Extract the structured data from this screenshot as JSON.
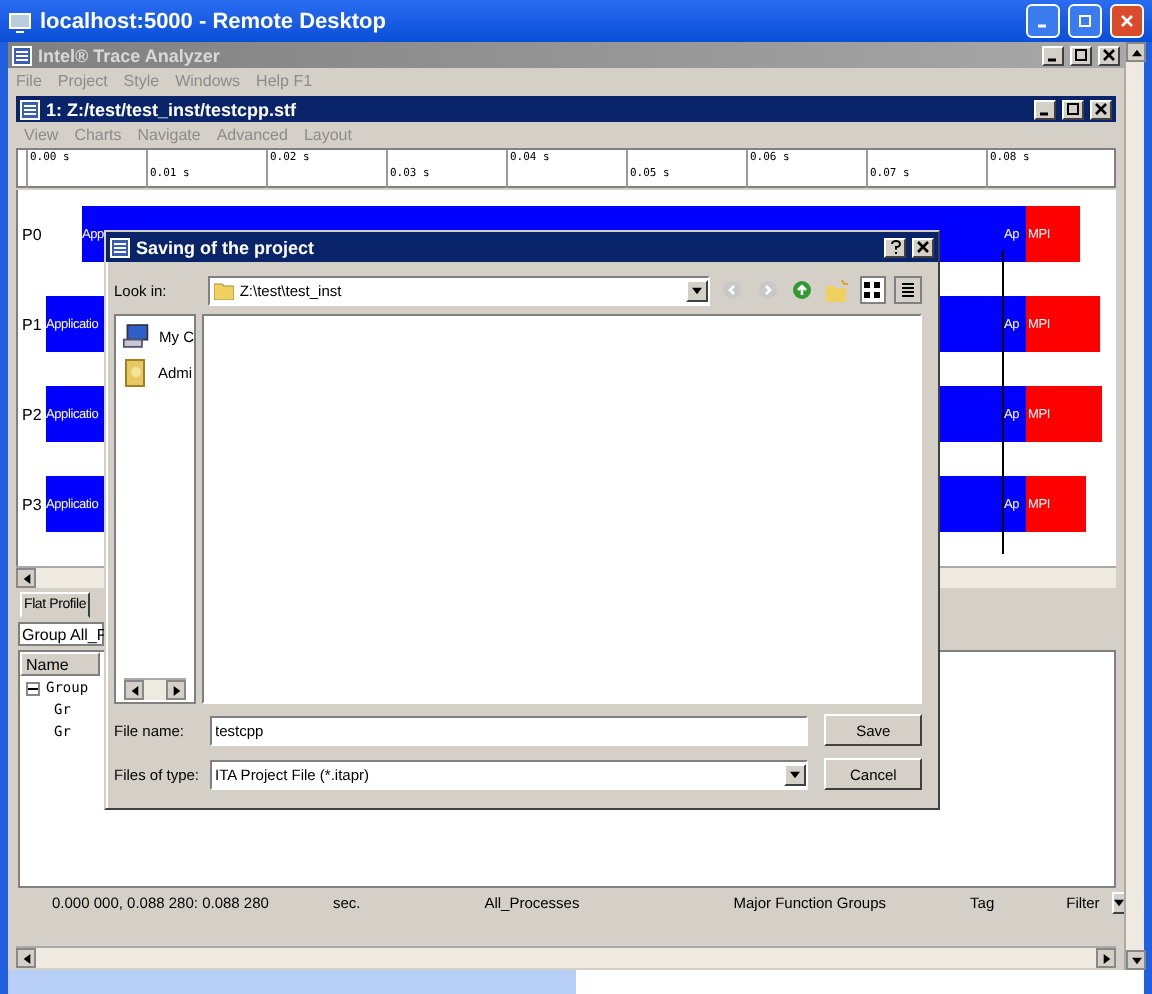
{
  "remote_window": {
    "title": "localhost:5000 - Remote Desktop"
  },
  "app_window": {
    "title": "Intel® Trace Analyzer",
    "menu": [
      {
        "label": "File",
        "disabled": true
      },
      {
        "label": "Project",
        "disabled": true
      },
      {
        "label": "Style",
        "disabled": true
      },
      {
        "label": "Windows",
        "disabled": true
      },
      {
        "label": "Help F1",
        "disabled": true
      }
    ]
  },
  "document_window": {
    "title": "1: Z:/test/test_inst/testcpp.stf",
    "menu": [
      {
        "label": "View",
        "disabled": true
      },
      {
        "label": "Charts",
        "disabled": true
      },
      {
        "label": "Navigate",
        "disabled": true
      },
      {
        "label": "Advanced",
        "disabled": true
      },
      {
        "label": "Layout",
        "disabled": true
      }
    ]
  },
  "ruler": {
    "ticks": [
      "0.00 s",
      "0.01 s",
      "0.02 s",
      "0.03 s",
      "0.04 s",
      "0.05 s",
      "0.06 s",
      "0.07 s",
      "0.08 s"
    ]
  },
  "timeline": {
    "rows": [
      {
        "label": "P0",
        "segments": [
          {
            "kind": "application",
            "text": "App"
          },
          {
            "kind": "application",
            "text": "Ap"
          },
          {
            "kind": "mpi",
            "text": "MPI"
          }
        ]
      },
      {
        "label": "P1",
        "segments": [
          {
            "kind": "application",
            "text": "Applicatio"
          },
          {
            "kind": "application",
            "text": "Ap"
          },
          {
            "kind": "mpi",
            "text": "MPI"
          }
        ]
      },
      {
        "label": "P2",
        "segments": [
          {
            "kind": "application",
            "text": "Applicatio"
          },
          {
            "kind": "application",
            "text": "Ap"
          },
          {
            "kind": "mpi",
            "text": "MPI"
          }
        ]
      },
      {
        "label": "P3",
        "segments": [
          {
            "kind": "application",
            "text": "Applicatio"
          },
          {
            "kind": "application",
            "text": "Ap"
          },
          {
            "kind": "mpi",
            "text": "MPI"
          }
        ]
      }
    ]
  },
  "profile": {
    "tabs": [
      {
        "label": "Flat Profile",
        "selected": true
      }
    ],
    "group_select": {
      "value": "Group All_P"
    },
    "columns": [
      "Name"
    ],
    "tree": [
      {
        "label": "Group",
        "expanded": true,
        "children": [
          {
            "label": "Gr"
          },
          {
            "label": "Gr"
          }
        ]
      }
    ]
  },
  "status_bar": {
    "time_range": "0.000 000, 0.088 280: 0.088 280",
    "unit": "sec.",
    "processes": "All_Processes",
    "grouping": "Major Function Groups",
    "tag": "Tag",
    "filter": "Filter"
  },
  "dialog": {
    "title": "Saving of the project",
    "look_in_label": "Look in:",
    "look_in": "Z:\\test\\test_inst",
    "places": [
      {
        "kind": "computer",
        "label": "My C"
      },
      {
        "kind": "user",
        "label": "Admi"
      }
    ],
    "file_name_label": "File name:",
    "file_name": "testcpp",
    "file_type_label": "Files of type:",
    "file_type": "ITA Project File (*.itapr)",
    "buttons": [
      "Save",
      "Cancel"
    ]
  }
}
